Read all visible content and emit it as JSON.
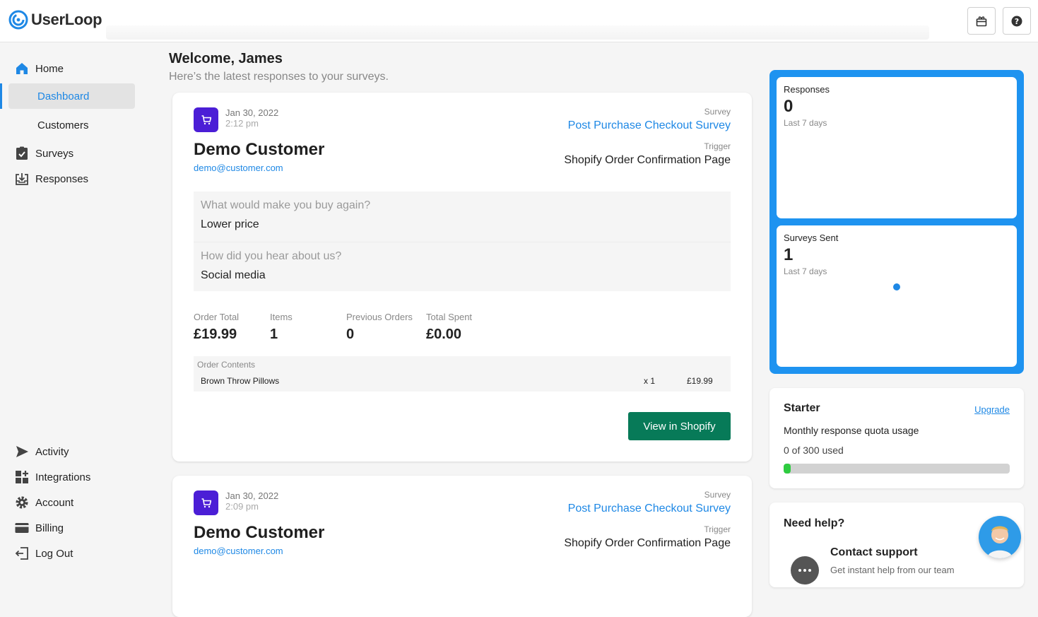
{
  "app": {
    "name": "UserLoop"
  },
  "header": {
    "gift_icon": "gift-icon",
    "help_icon": "help-icon"
  },
  "sidebar": {
    "home": "Home",
    "dashboard": "Dashboard",
    "customers": "Customers",
    "surveys": "Surveys",
    "responses": "Responses",
    "activity": "Activity",
    "integrations": "Integrations",
    "account": "Account",
    "billing": "Billing",
    "logout": "Log Out"
  },
  "main": {
    "welcome": "Welcome, James",
    "subtitle": "Here’s the latest responses to your surveys.",
    "responses": [
      {
        "date": "Jan 30, 2022",
        "time": "2:12 pm",
        "customer_name": "Demo Customer",
        "email": "demo@customer.com",
        "survey_label": "Survey",
        "survey_name": "Post Purchase Checkout Survey",
        "trigger_label": "Trigger",
        "trigger": "Shopify Order Confirmation Page",
        "answers": [
          {
            "question": "What would make you buy again?",
            "answer": "Lower price"
          },
          {
            "question": "How did you hear about us?",
            "answer": "Social media"
          }
        ],
        "stats": [
          {
            "label": "Order Total",
            "value": "£19.99"
          },
          {
            "label": "Items",
            "value": "1"
          },
          {
            "label": "Previous Orders",
            "value": "0"
          },
          {
            "label": "Total Spent",
            "value": "£0.00"
          }
        ],
        "order_contents_label": "Order Contents",
        "order_items": [
          {
            "name": "Brown Throw Pillows",
            "qty": "x 1",
            "price": "£19.99"
          }
        ],
        "button": "View in Shopify"
      },
      {
        "date": "Jan 30, 2022",
        "time": "2:09 pm",
        "customer_name": "Demo Customer",
        "email": "demo@customer.com",
        "survey_label": "Survey",
        "survey_name": "Post Purchase Checkout Survey",
        "trigger_label": "Trigger",
        "trigger": "Shopify Order Confirmation Page"
      }
    ]
  },
  "right": {
    "responses_card": {
      "title": "Responses",
      "value": "0",
      "period": "Last 7 days"
    },
    "surveys_sent_card": {
      "title": "Surveys Sent",
      "value": "1",
      "period": "Last 7 days"
    },
    "plan": {
      "name": "Starter",
      "upgrade": "Upgrade",
      "description": "Monthly response quota usage",
      "usage": "0 of 300 used",
      "usage_fraction": 0.0
    },
    "help": {
      "title": "Need help?",
      "contact_title": "Contact support",
      "contact_desc": "Get instant help from our team"
    }
  },
  "colors": {
    "accent": "#1e88e5",
    "stats_panel": "#1e93f0",
    "cart_badge": "#4b1ed6",
    "shopify_button": "#077a58",
    "quota_fill": "#2ecc40"
  }
}
